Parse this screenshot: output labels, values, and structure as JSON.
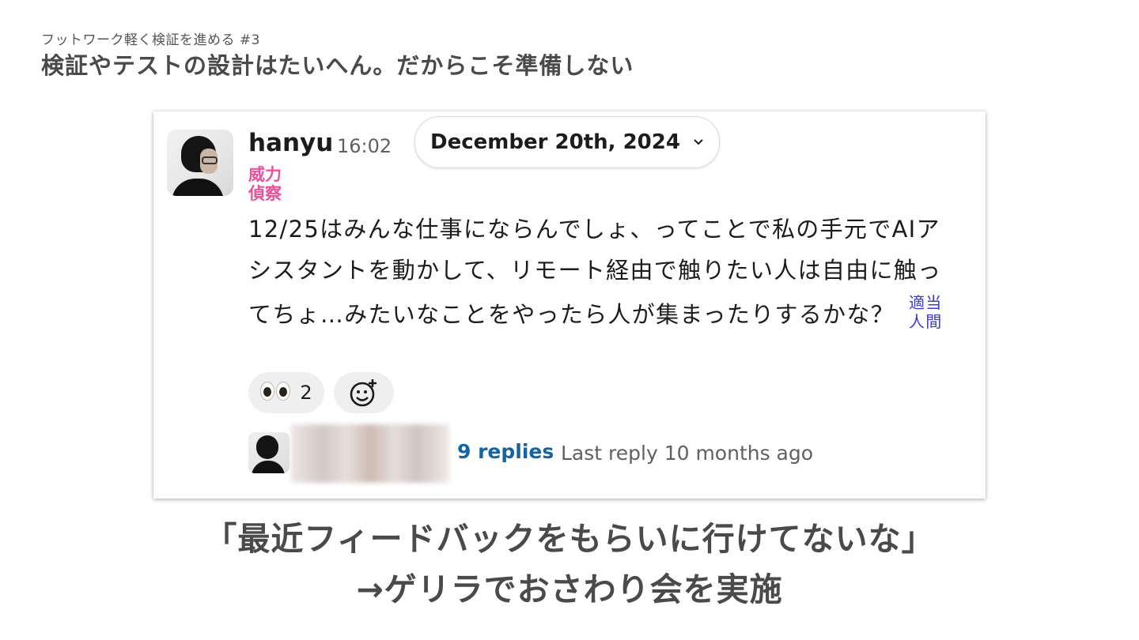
{
  "slide": {
    "subtitle": "フットワーク軽く検証を進める #3",
    "title": "検証やテストの設計はたいへん。だからこそ準備しない"
  },
  "message": {
    "username": "hanyu",
    "time": "16:02",
    "date": "December 20th, 2024",
    "status_text_line1": "威力",
    "status_text_line2": "偵察",
    "body": "12/25はみんな仕事にならんでしょ、ってことで私の手元でAIアシスタントを動かして、リモート経由で触りたい人は自由に触ってちょ…みたいなことをやったら人が集まったりするかな？",
    "stamp_text": "適当人間",
    "stamp_color": "#3b3bd0"
  },
  "reactions": [
    {
      "emoji": "eyes",
      "count": "2"
    },
    {
      "emoji": "add-reaction"
    }
  ],
  "thread": {
    "replies": "9 replies",
    "last_reply": "Last reply 10 months ago"
  },
  "caption": {
    "line1": "「最近フィードバックをもらいに行けてないな」",
    "line2": "→ゲリラでおさわり会を実施"
  }
}
